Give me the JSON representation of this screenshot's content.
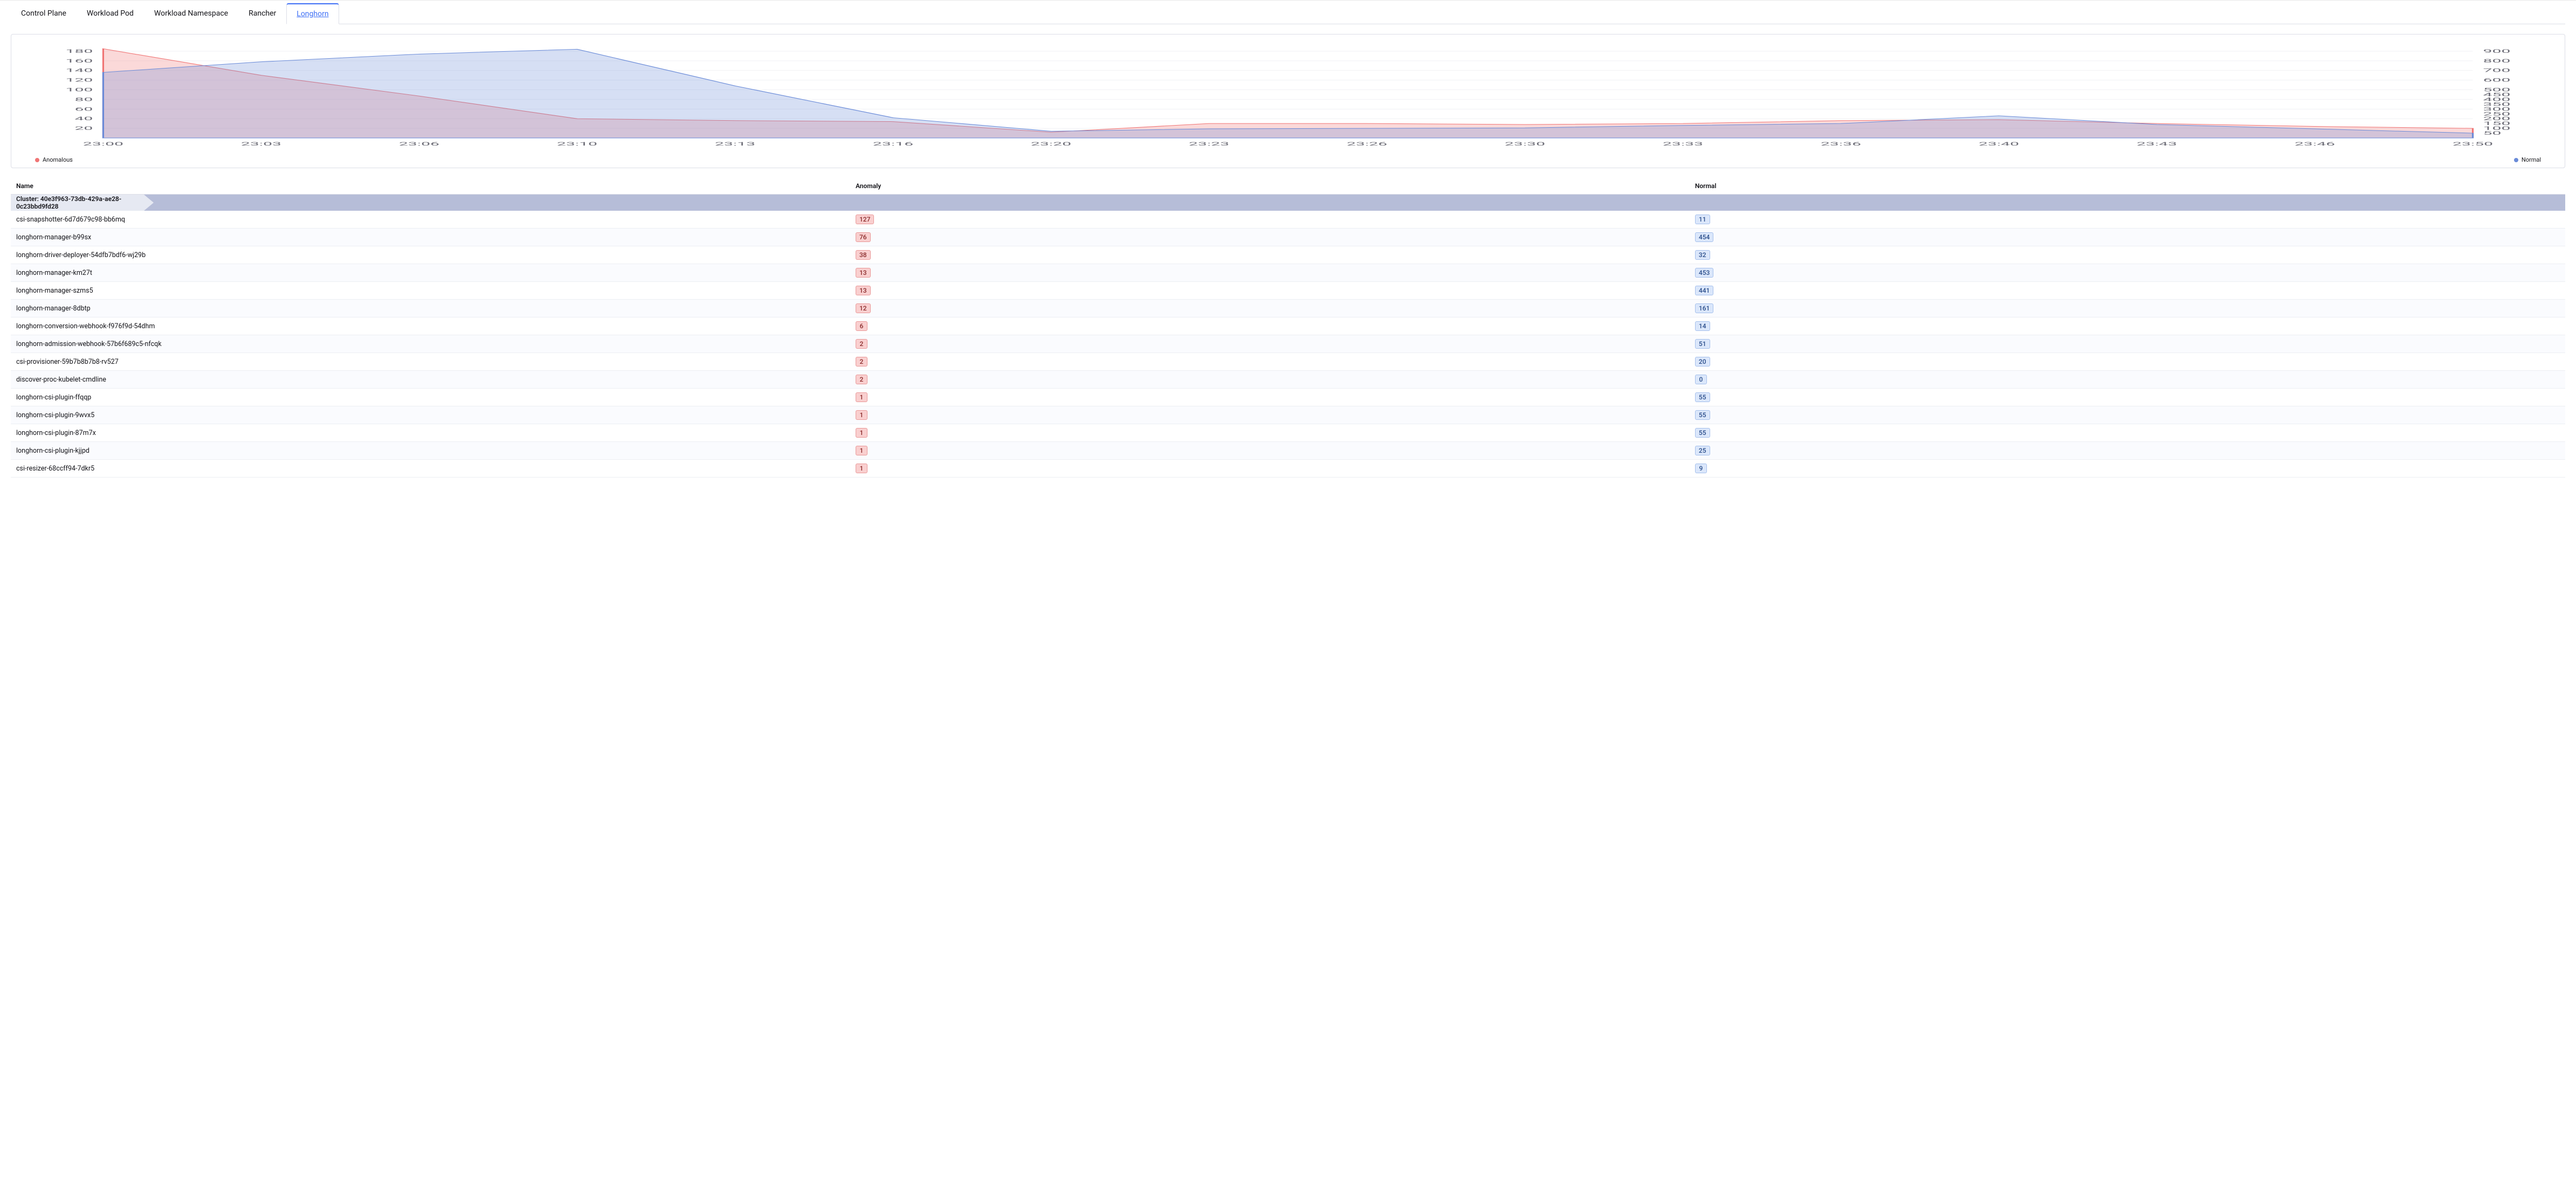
{
  "tabs": [
    {
      "label": "Control Plane",
      "active": false
    },
    {
      "label": "Workload Pod",
      "active": false
    },
    {
      "label": "Workload Namespace",
      "active": false
    },
    {
      "label": "Rancher",
      "active": false
    },
    {
      "label": "Longhorn",
      "active": true
    }
  ],
  "legend": {
    "anomalous": "Anomalous",
    "normal": "Normal"
  },
  "colors": {
    "anomalous": "#f07575",
    "normal": "#6a8bd8"
  },
  "chart_data": {
    "type": "area",
    "x_categories": [
      "23:00",
      "23:03",
      "23:06",
      "23:10",
      "23:13",
      "23:16",
      "23:20",
      "23:23",
      "23:26",
      "23:30",
      "23:33",
      "23:36",
      "23:40",
      "23:43",
      "23:46",
      "23:50"
    ],
    "left_axis": {
      "label": "",
      "ticks": [
        20,
        40,
        60,
        80,
        100,
        120,
        140,
        160,
        180
      ],
      "range": [
        0,
        190
      ]
    },
    "right_axis": {
      "label": "",
      "ticks": [
        50,
        100,
        150,
        200,
        250,
        300,
        350,
        400,
        450,
        500,
        600,
        700,
        800,
        900
      ],
      "range": [
        0,
        950
      ]
    },
    "series": [
      {
        "name": "Anomalous",
        "axis": "left",
        "color": "#f07575",
        "values": [
          185,
          130,
          87,
          40,
          36,
          34,
          12,
          30,
          30,
          28,
          30,
          36,
          38,
          30,
          24,
          20
        ]
      },
      {
        "name": "Normal",
        "axis": "right",
        "color": "#6a8bd8",
        "values": [
          680,
          790,
          870,
          920,
          540,
          210,
          70,
          95,
          100,
          105,
          130,
          150,
          230,
          140,
          95,
          50
        ]
      }
    ]
  },
  "table": {
    "columns": {
      "name": "Name",
      "anomaly": "Anomaly",
      "normal": "Normal"
    },
    "cluster_label": "Cluster: 40e3f963-73db-429a-ae28-0c23bbd9fd28",
    "rows": [
      {
        "name": "csi-snapshotter-6d7d679c98-bb6mq",
        "anomaly": 127,
        "normal": 11
      },
      {
        "name": "longhorn-manager-b99sx",
        "anomaly": 76,
        "normal": 454
      },
      {
        "name": "longhorn-driver-deployer-54dfb7bdf6-wj29b",
        "anomaly": 38,
        "normal": 32
      },
      {
        "name": "longhorn-manager-km27t",
        "anomaly": 13,
        "normal": 453
      },
      {
        "name": "longhorn-manager-szms5",
        "anomaly": 13,
        "normal": 441
      },
      {
        "name": "longhorn-manager-8dbtp",
        "anomaly": 12,
        "normal": 161
      },
      {
        "name": "longhorn-conversion-webhook-f976f9d-54dhm",
        "anomaly": 6,
        "normal": 14
      },
      {
        "name": "longhorn-admission-webhook-57b6f689c5-nfcqk",
        "anomaly": 2,
        "normal": 51
      },
      {
        "name": "csi-provisioner-59b7b8b7b8-rv527",
        "anomaly": 2,
        "normal": 20
      },
      {
        "name": "discover-proc-kubelet-cmdline",
        "anomaly": 2,
        "normal": 0
      },
      {
        "name": "longhorn-csi-plugin-ffqqp",
        "anomaly": 1,
        "normal": 55
      },
      {
        "name": "longhorn-csi-plugin-9wvx5",
        "anomaly": 1,
        "normal": 55
      },
      {
        "name": "longhorn-csi-plugin-87m7x",
        "anomaly": 1,
        "normal": 55
      },
      {
        "name": "longhorn-csi-plugin-kjjpd",
        "anomaly": 1,
        "normal": 25
      },
      {
        "name": "csi-resizer-68ccff94-7dkr5",
        "anomaly": 1,
        "normal": 9
      }
    ]
  }
}
